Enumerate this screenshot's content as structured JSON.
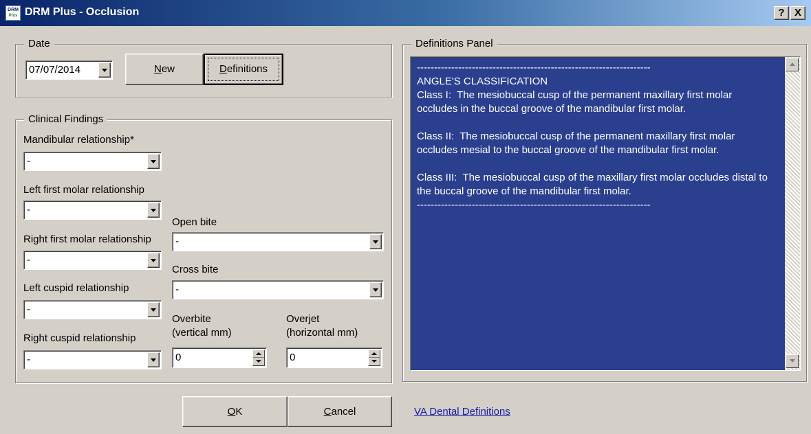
{
  "window": {
    "icon_text_top": "DRM",
    "icon_text_bottom": "Plus",
    "title": "DRM Plus - Occlusion",
    "help_label": "?",
    "close_label": "X"
  },
  "date_group": {
    "legend": "Date",
    "date_value": "07/07/2014",
    "new_button": {
      "mnemonic": "N",
      "rest": "ew"
    },
    "definitions_button": {
      "mnemonic": "D",
      "rest": "efinitions"
    }
  },
  "clinical": {
    "legend": "Clinical Findings",
    "mandibular_label": "Mandibular relationship*",
    "mandibular_value": "-",
    "left_first_molar_label": "Left first molar relationship",
    "left_first_molar_value": "-",
    "right_first_molar_label": "Right first molar relationship",
    "right_first_molar_value": "-",
    "left_cuspid_label": "Left cuspid relationship",
    "left_cuspid_value": "-",
    "right_cuspid_label": "Right cuspid relationship",
    "right_cuspid_value": "-",
    "open_bite_label": "Open bite",
    "open_bite_value": "-",
    "cross_bite_label": "Cross bite",
    "cross_bite_value": "-",
    "overbite_label_1": "Overbite",
    "overbite_label_2": "(vertical mm)",
    "overbite_value": "0",
    "overjet_label_1": "Overjet",
    "overjet_label_2": "(horizontal mm)",
    "overjet_value": "0"
  },
  "definitions_panel": {
    "legend": "Definitions Panel",
    "text": "--------------------------------------------------------------------\nANGLE'S CLASSIFICATION\nClass I:  The mesiobuccal cusp of the permanent maxillary first molar occludes in the buccal groove of the mandibular first molar.\n\nClass II:  The mesiobuccal cusp of the permanent maxillary first molar occludes mesial to the buccal groove of the mandibular first molar.\n\nClass III:  The mesiobuccal cusp of the maxillary first molar occludes distal to the buccal groove of the mandibular first molar.\n--------------------------------------------------------------------"
  },
  "footer": {
    "ok_button": {
      "mnemonic": "O",
      "rest": "K"
    },
    "cancel_button": {
      "mnemonic": "C",
      "rest": "ancel"
    },
    "link_text": "VA Dental Definitions"
  },
  "colors": {
    "title_gradient_start": "#0a246a",
    "panel_background": "#2b3f8f",
    "dialog_background": "#d4d0c8",
    "link": "#1a1aaa"
  }
}
